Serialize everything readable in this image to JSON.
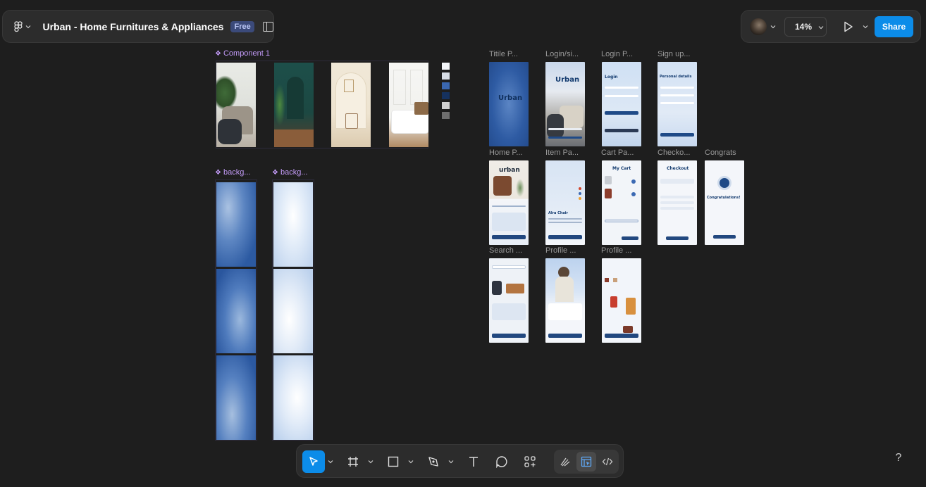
{
  "file": {
    "title": "Urban - Home Furnitures & Appliances",
    "plan_badge": "Free"
  },
  "top_right": {
    "zoom": "14%",
    "share_label": "Share"
  },
  "canvas": {
    "component_label": "Component 1",
    "background_labels": [
      "backg...",
      "backg..."
    ],
    "swatches": [
      "#f4f6f9",
      "#d7dde6",
      "#3a67b0",
      "#15315e",
      "#cfcfcf",
      "#6f6f6f"
    ],
    "screens_row1": [
      {
        "label": "Titile P...",
        "logo": "Urban"
      },
      {
        "label": "Login/si...",
        "logo": "Urban"
      },
      {
        "label": "Login P...",
        "heading": "Login"
      },
      {
        "label": "Sign up...",
        "heading": "Personal details"
      }
    ],
    "screens_row2": [
      {
        "label": "Home P...",
        "logo": "urban"
      },
      {
        "label": "Item Pa...",
        "heading": "Alra Chair"
      },
      {
        "label": "Cart Pa...",
        "heading": "My Cart"
      },
      {
        "label": "Checko...",
        "heading": "Checkout"
      },
      {
        "label": "Congrats",
        "heading": "Congratulations!"
      }
    ],
    "screens_row3": [
      {
        "label": "Search ..."
      },
      {
        "label": "Profile ..."
      },
      {
        "label": "Profile ..."
      }
    ]
  },
  "toolbar": {
    "tools": [
      "move-tool",
      "frame-tool",
      "shape-tool",
      "pen-tool",
      "text-tool",
      "comment-tool",
      "actions-tool"
    ],
    "modes": [
      "draw-mode",
      "design-mode",
      "dev-mode"
    ],
    "help_label": "?"
  },
  "colors": {
    "accent": "#0c8ce9",
    "component": "#c29af7",
    "canvas": "#1e1e1e",
    "panel": "#2c2c2c"
  }
}
